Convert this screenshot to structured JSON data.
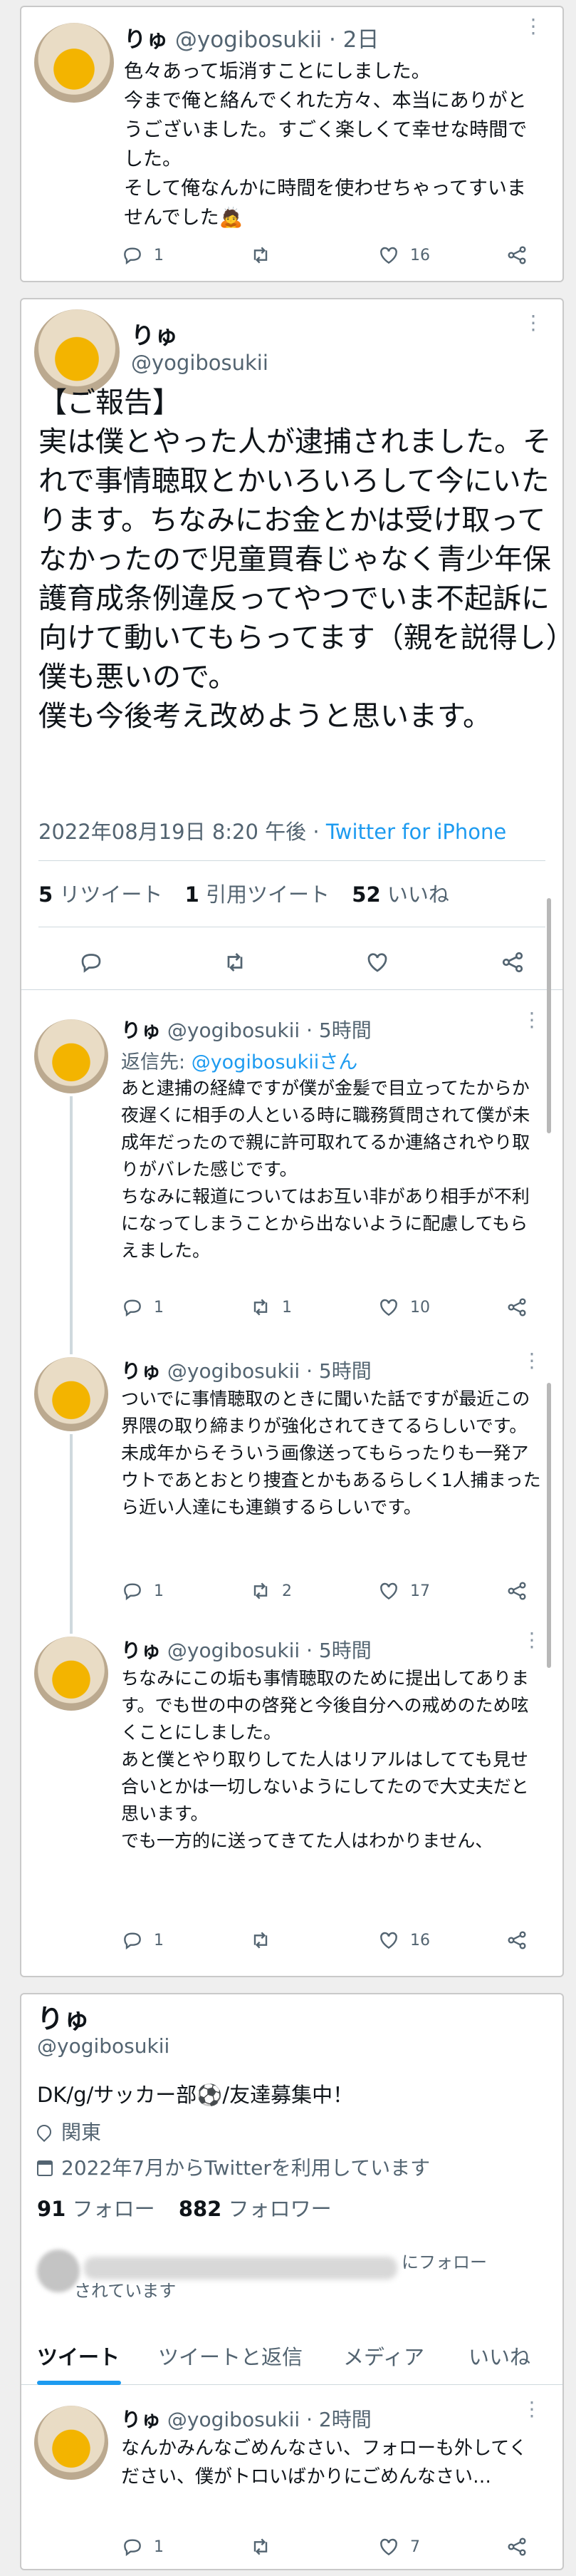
{
  "tweet1": {
    "name": "りゅ",
    "handle": "@yogibosukii",
    "time": "2日",
    "text": "色々あって垢消すことにしました。\n今まで俺と絡んでくれた方々、本当にありがとうございました。すごく楽しくて幸せな時間でした。\nそして俺なんかに時間を使わせちゃってすいませんでした🙇",
    "replies": "1",
    "retweets": "",
    "likes": "16"
  },
  "main": {
    "name": "りゅ",
    "handle": "@yogibosukii",
    "text": "【ご報告】\n実は僕とやった人が逮捕されました。それで事情聴取とかいろいろして今にいたります。ちなみにお金とかは受け取ってなかったので児童買春じゃなく青少年保護育成条例違反ってやつでいま不起訴に向けて動いてもらってます（親を説得し）僕も悪いので。\n僕も今後考え改めようと思います。",
    "date": "2022年08月19日 8:20 午後 · ",
    "client": "Twitter for iPhone",
    "rt_count": "5",
    "rt_label": "リツイート",
    "qt_count": "1",
    "qt_label": "引用ツイート",
    "like_count": "52",
    "like_label": "いいね"
  },
  "reply1": {
    "name": "りゅ",
    "handle": "@yogibosukii",
    "time": "5時間",
    "reply_to_prefix": "返信先: ",
    "reply_to": "@yogibosukiiさん",
    "text": "あと逮捕の経緯ですが僕が金髪で目立ってたからか夜遅くに相手の人といる時に職務質問されて僕が未成年だったので親に許可取れてるか連絡されやり取りがバレた感じです。\nちなみに報道についてはお互い非があり相手が不利になってしまうことから出ないように配慮してもらえました。",
    "replies": "1",
    "retweets": "1",
    "likes": "10"
  },
  "reply2": {
    "name": "りゅ",
    "handle": "@yogibosukii",
    "time": "5時間",
    "text": "ついでに事情聴取のときに聞いた話ですが最近この界隈の取り締まりが強化されてきてるらしいです。未成年からそういう画像送ってもらったりも一発アウトであとおとり捜査とかもあるらしく1人捕まったら近い人達にも連鎖するらしいです。",
    "replies": "1",
    "retweets": "2",
    "likes": "17"
  },
  "reply3": {
    "name": "りゅ",
    "handle": "@yogibosukii",
    "time": "5時間",
    "text": "ちなみにこの垢も事情聴取のために提出してあります。でも世の中の啓発と今後自分への戒めのため呟くことにしました。\nあと僕とやり取りしてた人はリアルはしてても見せ合いとかは一切しないようにしてたので大丈夫だと思います。\nでも一方的に送ってきてた人はわかりません、",
    "replies": "1",
    "retweets": "",
    "likes": "16"
  },
  "profile": {
    "name": "りゅ",
    "handle": "@yogibosukii",
    "bio": "DK/g/サッカー部⚽️/友達募集中！",
    "location": "関東",
    "joined": "2022年7月からTwitterを利用しています",
    "following_count": "91",
    "following_label": "フォロー",
    "followers_count": "882",
    "followers_label": "フォロワー",
    "followed_by_suffix": "にフォローされています",
    "tabs": [
      "ツイート",
      "ツイートと返信",
      "メディア",
      "いいね"
    ]
  },
  "tweet_last": {
    "name": "りゅ",
    "handle": "@yogibosukii",
    "time": "2時間",
    "text": "なんかみんなごめんなさい、フォローも外してください、僕がトロいばかりにごめんなさい…",
    "replies": "1",
    "retweets": "",
    "likes": "7"
  },
  "colors": {
    "accent": "#1d9bf0",
    "text": "#0f1419",
    "secondary": "#536471"
  }
}
